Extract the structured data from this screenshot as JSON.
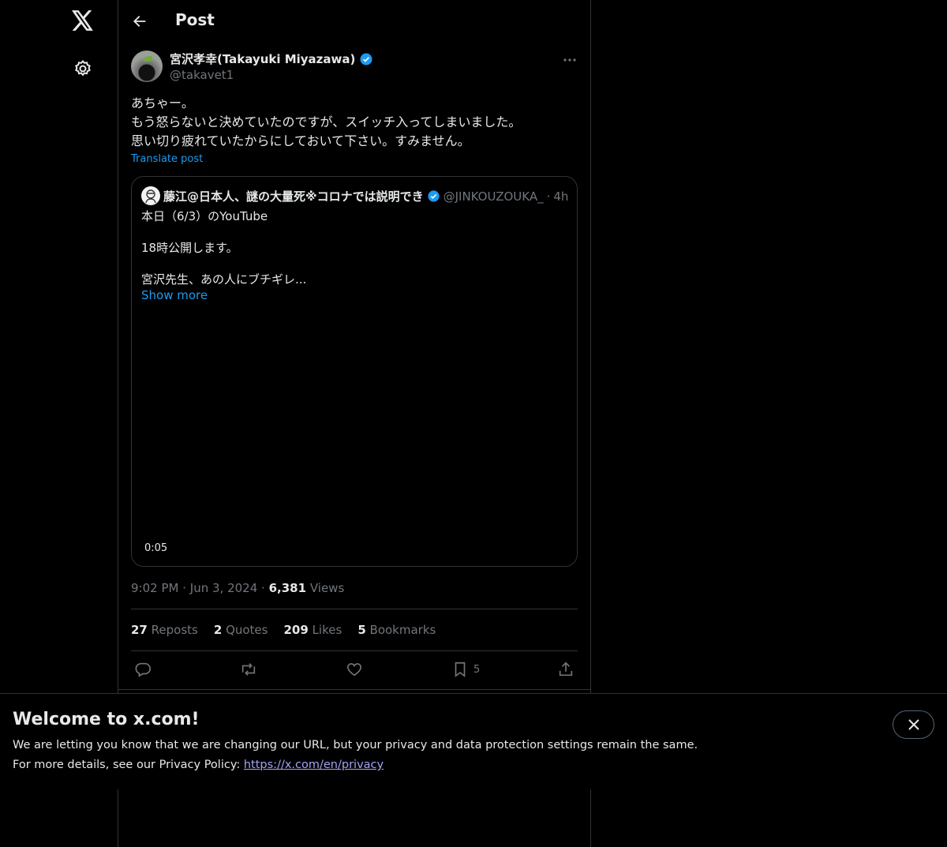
{
  "header": {
    "title": "Post"
  },
  "post": {
    "author_name": "宮沢孝幸(Takayuki Miyazawa)",
    "author_handle": "@takavet1",
    "lines": [
      "あちゃー。",
      "もう怒らないと決めていたのですが、スイッチ入ってしまいました。",
      "思い切り疲れていたからにしておいて下さい。すみません。"
    ],
    "translate_label": "Translate post",
    "time": "9:02 PM",
    "date": "Jun 3, 2024",
    "views_count": "6,381",
    "views_label": "Views",
    "separator": "·"
  },
  "quote": {
    "author_name": "藤江@日本人、謎の大量死※コロナでは説明でき",
    "author_handle": "@JINKOUZOUKA_",
    "separator": "·",
    "time": "4h",
    "text_1": "本日（6/3）のYouTube",
    "text_2": "18時公開します。",
    "text_3": "宮沢先生、あの人にブチギレ...",
    "show_more": "Show more",
    "video_duration": "0:05"
  },
  "stats": {
    "reposts_count": "27",
    "reposts_label": "Reposts",
    "quotes_count": "2",
    "quotes_label": "Quotes",
    "likes_count": "209",
    "likes_label": "Likes",
    "bookmarks_count": "5",
    "bookmarks_label": "Bookmarks"
  },
  "actions": {
    "bookmark_count": "5"
  },
  "banner": {
    "title": "Welcome to x.com!",
    "line1": "We are letting you know that we are changing our URL, but your privacy and data protection settings remain the same.",
    "line2_prefix": "For more details, see our Privacy Policy: ",
    "link": "https://x.com/en/privacy"
  },
  "colors": {
    "background": "#000000",
    "text": "#e7e9ea",
    "secondary": "#71767b",
    "accent": "#1d9bf0",
    "border": "#2f3336"
  },
  "icons": [
    "x-logo-icon",
    "settings-icon",
    "back-arrow-icon",
    "verified-badge-icon",
    "more-options-icon",
    "reply-icon",
    "repost-icon",
    "like-icon",
    "bookmark-icon",
    "share-icon",
    "close-icon"
  ]
}
